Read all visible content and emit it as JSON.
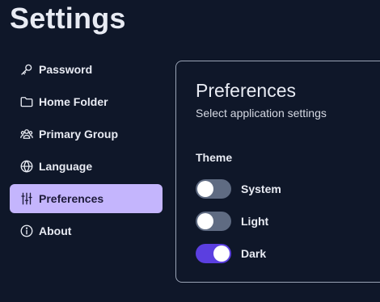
{
  "page": {
    "title": "Settings"
  },
  "sidebar": {
    "items": [
      {
        "label": "Password",
        "icon": "key-icon",
        "active": false
      },
      {
        "label": "Home Folder",
        "icon": "folder-icon",
        "active": false
      },
      {
        "label": "Primary Group",
        "icon": "group-icon",
        "active": false
      },
      {
        "label": "Language",
        "icon": "globe-icon",
        "active": false
      },
      {
        "label": "Preferences",
        "icon": "sliders-icon",
        "active": true
      },
      {
        "label": "About",
        "icon": "info-icon",
        "active": false
      }
    ]
  },
  "preferences": {
    "title": "Preferences",
    "subtitle": "Select application settings",
    "theme": {
      "label": "Theme",
      "options": [
        {
          "label": "System",
          "on": false
        },
        {
          "label": "Light",
          "on": false
        },
        {
          "label": "Dark",
          "on": true
        }
      ]
    }
  },
  "colors": {
    "background": "#0f1729",
    "active_item": "#c4b5fd",
    "toggle_on": "#5b3fe0",
    "toggle_off": "#5f6b82",
    "panel_border": "#9aa3b5"
  }
}
